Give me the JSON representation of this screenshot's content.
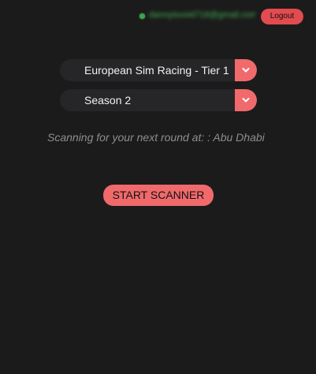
{
  "header": {
    "user_email": "dannyisvoid718@gmail.com",
    "logout_label": "Logout",
    "status_color": "#3fa34d"
  },
  "form": {
    "series_select": {
      "selected": "European Sim Racing - Tier 1",
      "icon": "chevron-down-icon"
    },
    "season_select": {
      "selected": "Season 2",
      "icon": "chevron-down-icon"
    },
    "scan_status": "Scanning for your next round at: : Abu Dhabi",
    "start_button_label": "START SCANNER"
  },
  "colors": {
    "background": "#1c1b1c",
    "accent": "#f06a6c",
    "logout": "#e24b4f",
    "status_text": "#8e8d8f"
  }
}
